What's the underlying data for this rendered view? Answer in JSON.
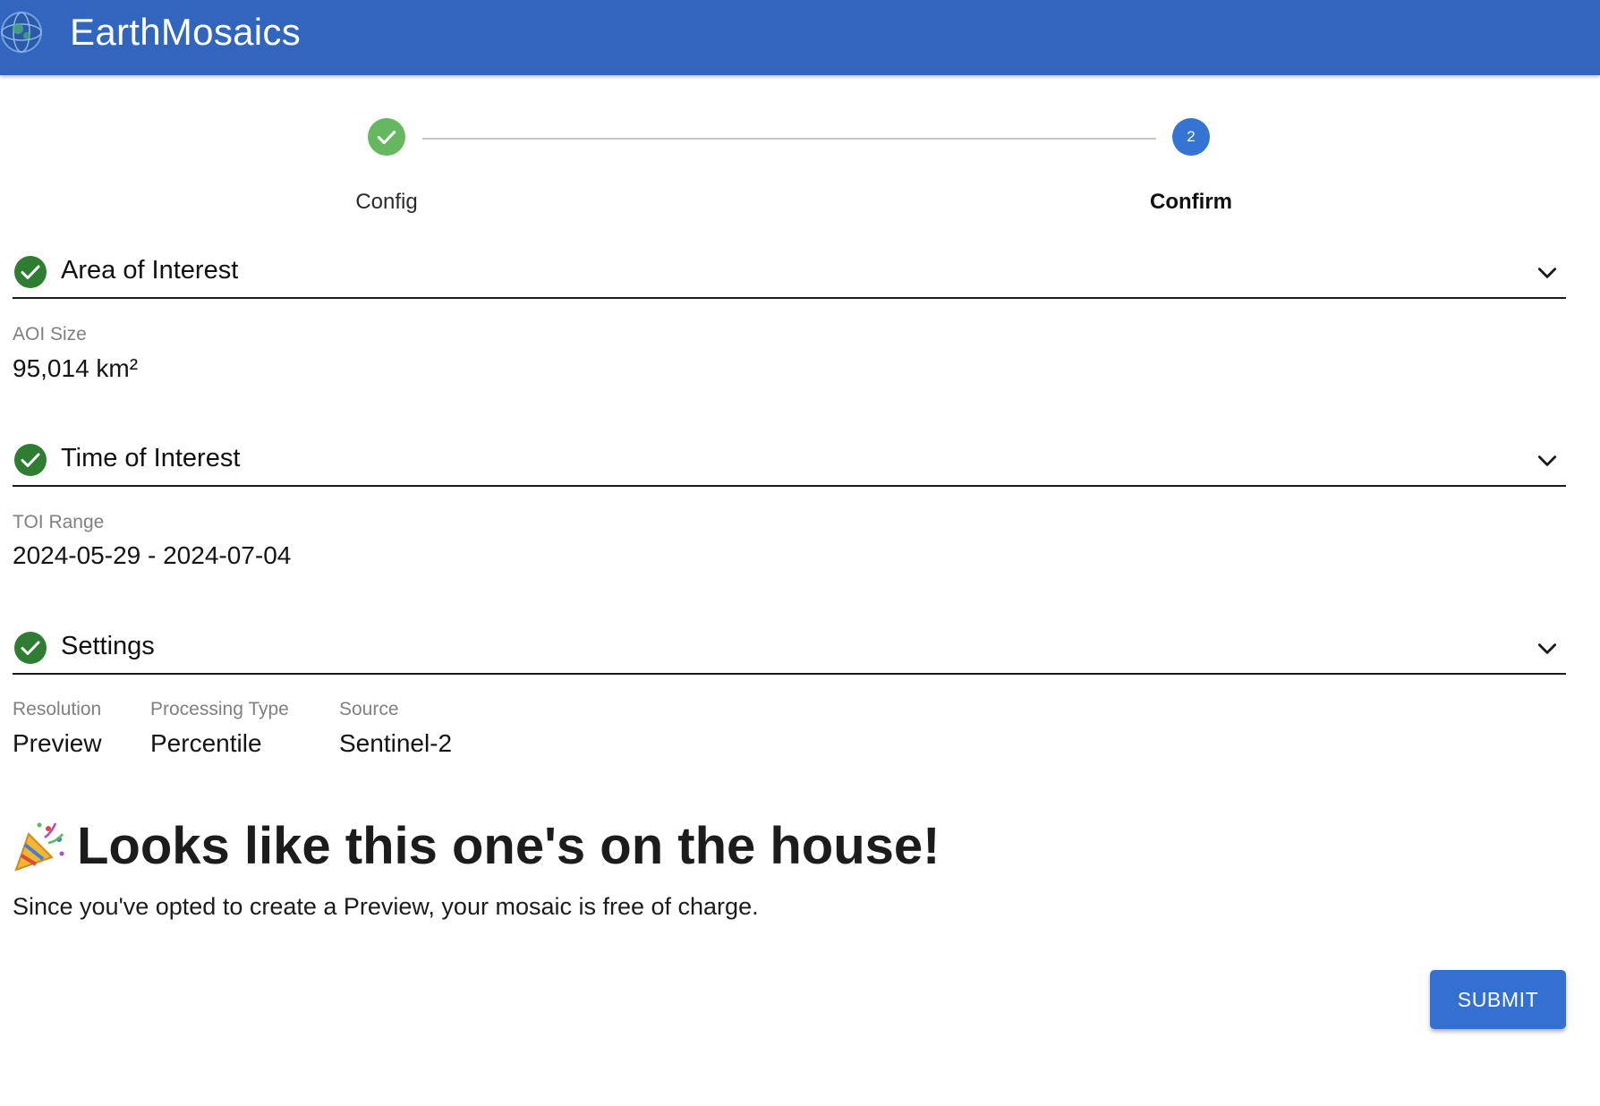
{
  "app": {
    "title": "EarthMosaics",
    "logo_icon": "globe-logo-icon",
    "bar_color": "#3165be"
  },
  "stepper": {
    "steps": [
      {
        "label": "Config",
        "status": "complete",
        "indicator": "check-icon",
        "color": "#66b860"
      },
      {
        "label": "Confirm",
        "status": "active",
        "number": "2",
        "color": "#3574d3"
      }
    ]
  },
  "sections": {
    "aoi": {
      "title": "Area of Interest",
      "fields": [
        {
          "label": "AOI Size",
          "value": "95,014 km²"
        }
      ]
    },
    "toi": {
      "title": "Time of Interest",
      "fields": [
        {
          "label": "TOI Range",
          "value": "2024-05-29 - 2024-07-04"
        }
      ]
    },
    "settings": {
      "title": "Settings",
      "fields": [
        {
          "label": "Resolution",
          "value": "Preview"
        },
        {
          "label": "Processing Type",
          "value": "Percentile"
        },
        {
          "label": "Source",
          "value": "Sentinel-2"
        }
      ]
    }
  },
  "promo": {
    "icon": "party-popper-icon",
    "heading": "Looks like this one's on the house!",
    "text": "Since you've opted to create a Preview, your mosaic is free of charge."
  },
  "actions": {
    "submit_label": "SUBMIT",
    "submit_color": "#3370d0"
  },
  "colors": {
    "section_check": "#2e7d32",
    "label_gray": "#808080"
  }
}
